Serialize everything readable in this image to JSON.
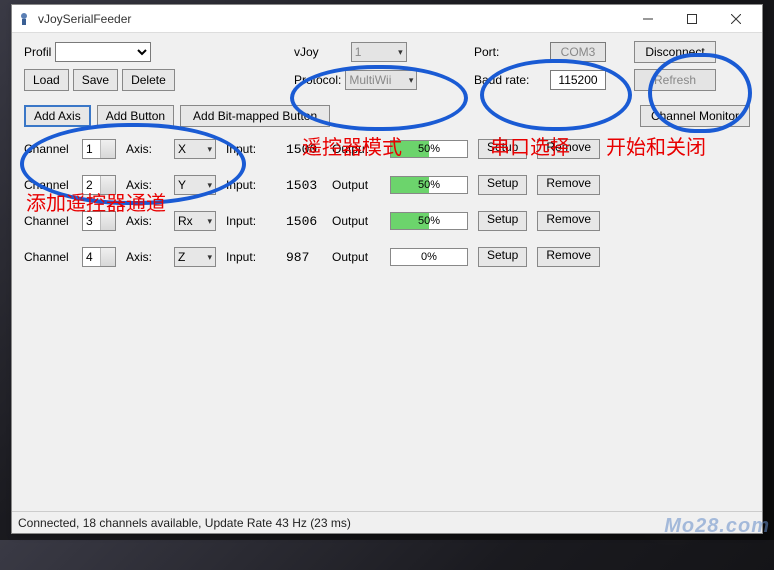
{
  "window": {
    "title": "vJoySerialFeeder"
  },
  "profil": {
    "label": "Profil",
    "value": ""
  },
  "buttons": {
    "load": "Load",
    "save": "Save",
    "delete": "Delete"
  },
  "vjoy": {
    "label": "vJoy",
    "device": "1"
  },
  "protocol": {
    "label": "Protocol:",
    "value": "MultiWii"
  },
  "port": {
    "label": "Port:",
    "value": "COM3"
  },
  "baud": {
    "label": "Baud rate:",
    "value": "115200"
  },
  "disconnect": "Disconnect",
  "refresh": "Refresh",
  "toolbar": {
    "add_axis": "Add Axis",
    "add_button": "Add Button",
    "add_bitmapped": "Add Bit-mapped Button",
    "channel_monitor": "Channel Monitor"
  },
  "rows": [
    {
      "ch_label": "Channel",
      "ch": "1",
      "axis_label": "Axis:",
      "axis": "X",
      "in_label": "Input:",
      "in": "1500",
      "out_label": "Output",
      "pct": "50%",
      "bar": 50,
      "setup": "Setup",
      "remove": "Remove"
    },
    {
      "ch_label": "Channel",
      "ch": "2",
      "axis_label": "Axis:",
      "axis": "Y",
      "in_label": "Input:",
      "in": "1503",
      "out_label": "Output",
      "pct": "50%",
      "bar": 50,
      "setup": "Setup",
      "remove": "Remove"
    },
    {
      "ch_label": "Channel",
      "ch": "3",
      "axis_label": "Axis:",
      "axis": "Rx",
      "in_label": "Input:",
      "in": "1506",
      "out_label": "Output",
      "pct": "50%",
      "bar": 50,
      "setup": "Setup",
      "remove": "Remove"
    },
    {
      "ch_label": "Channel",
      "ch": "4",
      "axis_label": "Axis:",
      "axis": "Z",
      "in_label": "Input:",
      "in": "987",
      "out_label": "Output",
      "pct": "0%",
      "bar": 0,
      "setup": "Setup",
      "remove": "Remove"
    }
  ],
  "status": "Connected, 18 channels available, Update Rate 43 Hz (23 ms)",
  "annotations": {
    "protocol": "遥控器模式",
    "port": "串口选择",
    "connect": "开始和关闭",
    "add_axis": "添加遥控器通道"
  },
  "watermark": "Mo28.com"
}
